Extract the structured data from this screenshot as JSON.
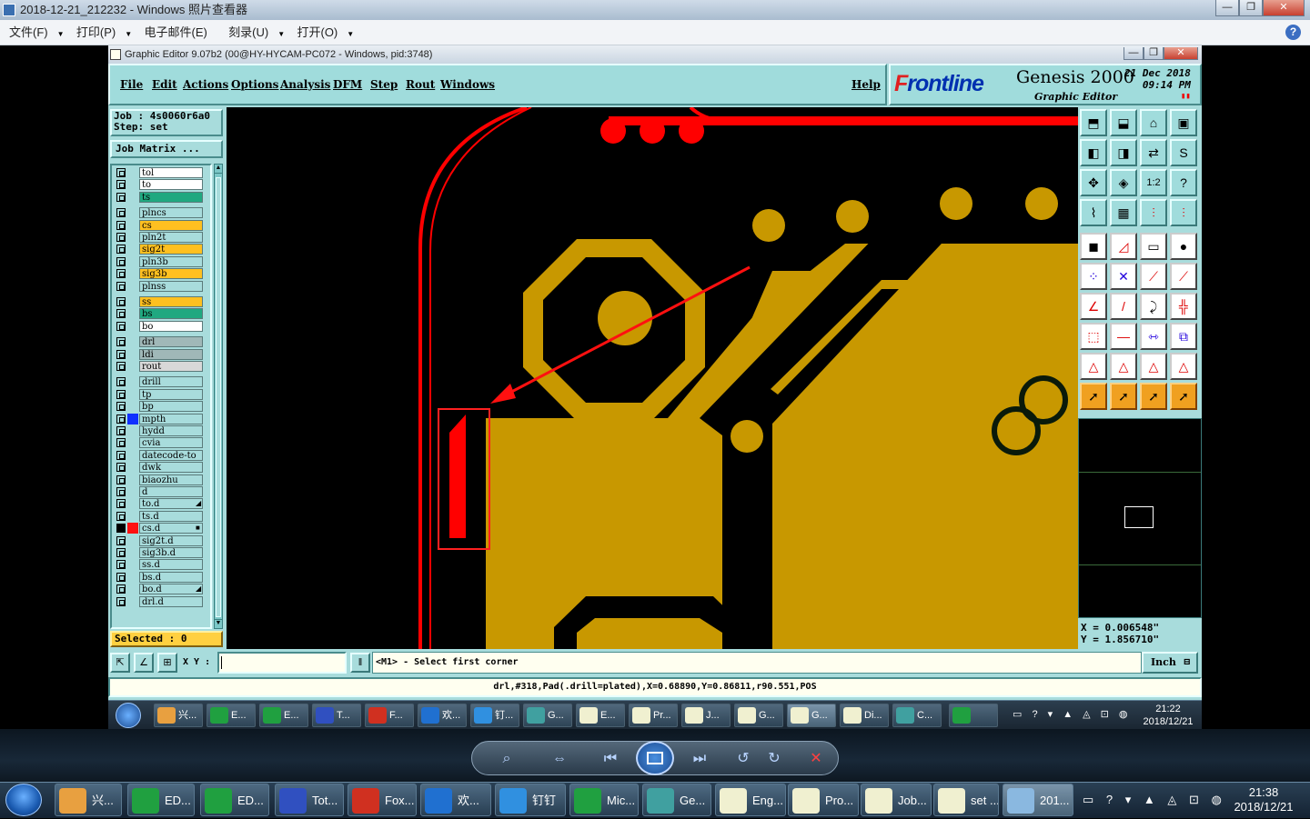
{
  "viewer": {
    "title": "2018-12-21_212232 - Windows 照片查看器",
    "menu": [
      "文件(F)",
      "打印(P)",
      "电子邮件(E)",
      "刻录(U)",
      "打开(O)"
    ],
    "help": "?",
    "win_buttons": [
      "—",
      "❐",
      "✕"
    ]
  },
  "genesis": {
    "title": "Graphic Editor 9.07b2 (00@HY-HYCAM-PC072 - Windows, pid:3748)",
    "menu": [
      "File",
      "Edit",
      "Actions",
      "Options",
      "Analysis",
      "DFM",
      "Step",
      "Rout",
      "Windows"
    ],
    "help": "Help",
    "logo": {
      "brand_pre": "F",
      "brand_post": "rontline",
      "product": "Genesis 2000",
      "subtitle": "Graphic Editor",
      "date": "21 Dec 2018",
      "time": "09:14 PM"
    },
    "job": "Job : 4s0060r6a0",
    "step": "Step: set",
    "job_matrix": "Job Matrix ...",
    "layers": [
      {
        "name": "tol",
        "color": "#ffffff",
        "sel": ""
      },
      {
        "name": "to",
        "color": "#ffffff",
        "sel": ""
      },
      {
        "name": "ts",
        "color": "#20a880",
        "sel": ""
      },
      {
        "name": "plncs",
        "color": "#a8dcdc",
        "sel": "",
        "gap": true
      },
      {
        "name": "cs",
        "color": "#ffc020",
        "sel": ""
      },
      {
        "name": "pln2t",
        "color": "#a8dcdc",
        "sel": ""
      },
      {
        "name": "sig2t",
        "color": "#ffc020",
        "sel": ""
      },
      {
        "name": "pln3b",
        "color": "#a8dcdc",
        "sel": ""
      },
      {
        "name": "sig3b",
        "color": "#ffc020",
        "sel": ""
      },
      {
        "name": "plnss",
        "color": "#a8dcdc",
        "sel": ""
      },
      {
        "name": "ss",
        "color": "#ffc020",
        "sel": "",
        "gap": true
      },
      {
        "name": "bs",
        "color": "#20a880",
        "sel": ""
      },
      {
        "name": "bo",
        "color": "#ffffff",
        "sel": ""
      },
      {
        "name": "drl",
        "color": "#a0b8b8",
        "sel": "",
        "gap": true
      },
      {
        "name": "ldi",
        "color": "#a0b8b8",
        "sel": ""
      },
      {
        "name": "rout",
        "color": "#d8d8d8",
        "sel": ""
      },
      {
        "name": "drill",
        "color": "#a8dcdc",
        "sel": "",
        "gap": true
      },
      {
        "name": "tp",
        "color": "#a8dcdc",
        "sel": ""
      },
      {
        "name": "bp",
        "color": "#a8dcdc",
        "sel": ""
      },
      {
        "name": "mpth",
        "color": "#a8dcdc",
        "sel": "",
        "swatch": "#1030ff"
      },
      {
        "name": "hydd",
        "color": "#a8dcdc",
        "sel": ""
      },
      {
        "name": "cvia",
        "color": "#a8dcdc",
        "sel": ""
      },
      {
        "name": "datecode-to",
        "color": "#a8dcdc",
        "sel": ""
      },
      {
        "name": "dwk",
        "color": "#a8dcdc",
        "sel": ""
      },
      {
        "name": "biaozhu",
        "color": "#a8dcdc",
        "sel": ""
      },
      {
        "name": "d",
        "color": "#a8dcdc",
        "sel": ""
      },
      {
        "name": "to.d",
        "color": "#a8dcdc",
        "sel": "◢"
      },
      {
        "name": "ts.d",
        "color": "#a8dcdc",
        "sel": ""
      },
      {
        "name": "cs.d",
        "color": "#a8dcdc",
        "sel": "■",
        "swatch": "#ff1010",
        "checked": true
      },
      {
        "name": "sig2t.d",
        "color": "#a8dcdc",
        "sel": ""
      },
      {
        "name": "sig3b.d",
        "color": "#a8dcdc",
        "sel": ""
      },
      {
        "name": "ss.d",
        "color": "#a8dcdc",
        "sel": ""
      },
      {
        "name": "bs.d",
        "color": "#a8dcdc",
        "sel": ""
      },
      {
        "name": "bo.d",
        "color": "#a8dcdc",
        "sel": "◢"
      },
      {
        "name": "drl.d",
        "color": "#a8dcdc",
        "sel": ""
      }
    ],
    "selected": "Selected : 0",
    "coords": {
      "x": "X = 0.006548\"",
      "y": "Y = 1.856710\""
    },
    "xy_label": "X Y :",
    "prompt": "<M1> - Select first corner",
    "units": "Inch",
    "status": "drl,#318,Pad(.drill=plated),X=0.68890,Y=0.86811,r90.551,POS",
    "colors": {
      "copper": "#c89800",
      "outline": "#ff0000",
      "highlight": "#ff0000",
      "panel": "#a8dcdc"
    }
  },
  "inner_taskbar": {
    "items": [
      "兴...",
      "E...",
      "E...",
      "T...",
      "F...",
      "欢...",
      "钉...",
      "G...",
      "E...",
      "Pr...",
      "J...",
      "G...",
      "G...",
      "Di...",
      "C...",
      ""
    ],
    "time": "21:22",
    "date": "2018/12/21"
  },
  "taskbar": {
    "items": [
      "兴...",
      "ED...",
      "ED...",
      "Tot...",
      "Fox...",
      "欢...",
      "钉钉",
      "Mic...",
      "Ge...",
      "Eng...",
      "Pro...",
      "Job...",
      "set ...",
      "201..."
    ],
    "time": "21:38",
    "date": "2018/12/21"
  }
}
